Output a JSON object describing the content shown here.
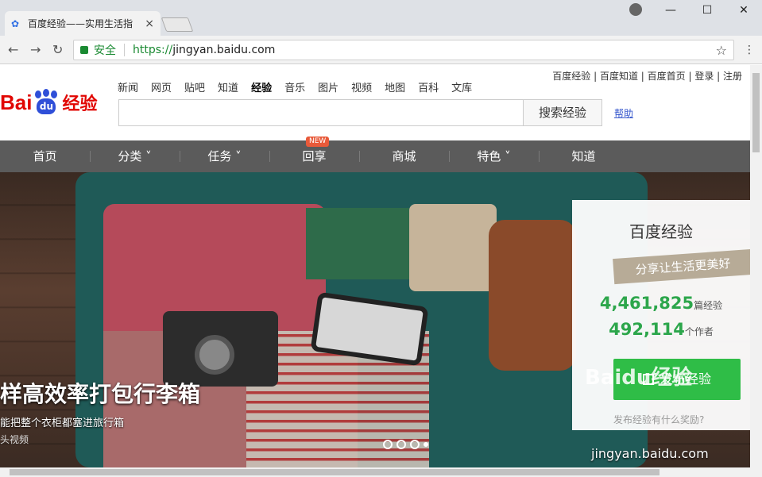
{
  "browser": {
    "tab_title": "百度经验——实用生活指",
    "tab_close": "×",
    "security_label": "安全",
    "url_scheme": "https://",
    "url_host": "jingyan.baidu.com",
    "window_min": "—",
    "window_max": "☐",
    "window_close": "✕",
    "back": "←",
    "forward": "→",
    "reload": "↻",
    "star": "☆",
    "menu": "⋮"
  },
  "header": {
    "logo_text": "Bai",
    "logo_du": "du",
    "logo_suffix": "经验",
    "top_links": "百度经验 | 百度知道 | 百度首页 | 登录 | 注册",
    "channels": [
      "新闻",
      "网页",
      "贴吧",
      "知道",
      "经验",
      "音乐",
      "图片",
      "视频",
      "地图",
      "百科",
      "文库"
    ],
    "search_button": "搜索经验",
    "search_value": "",
    "help_link": "帮助"
  },
  "mainnav": {
    "items": [
      "首页",
      "分类 ˅",
      "任务 ˅",
      "回享",
      "商城",
      "特色 ˅",
      "知道"
    ],
    "new_badge": "NEW"
  },
  "hero": {
    "title": "样高效率打包行李箱",
    "subtitle": "能把整个衣柜都塞进旅行箱",
    "source": "头视频"
  },
  "panel": {
    "title": "百度经验",
    "slogan": "分享让生活更美好",
    "articles_count": "4,461,825",
    "articles_unit": "篇经验",
    "authors_count": "492,114",
    "authors_unit": "个作者",
    "publish_button": "发布经验",
    "question": "发布经验有什么奖励?"
  },
  "watermark": {
    "logo": "Baidu经验",
    "url": "jingyan.baidu.com"
  }
}
